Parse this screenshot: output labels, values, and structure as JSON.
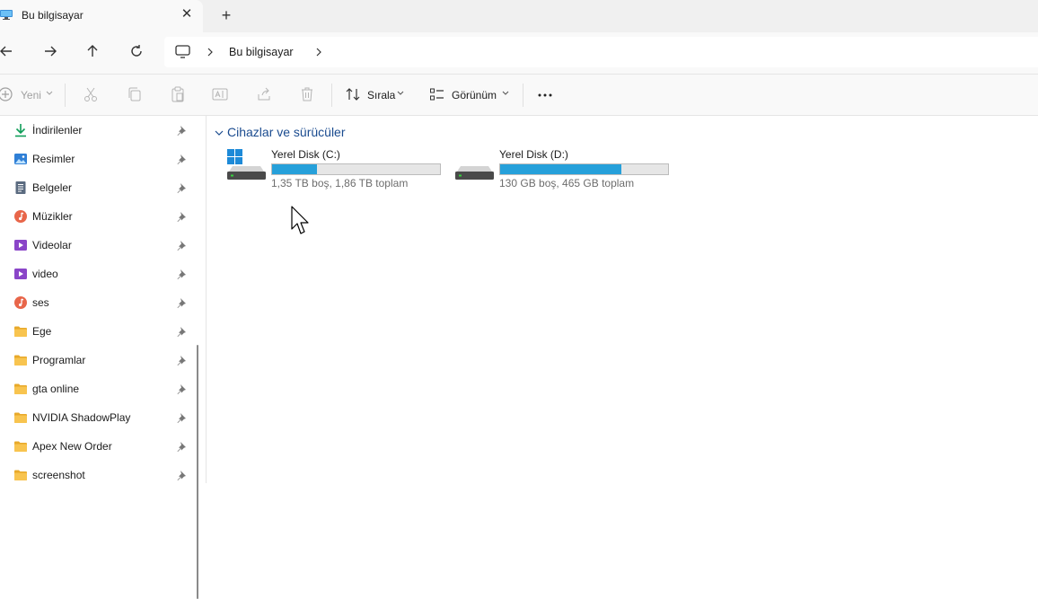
{
  "tab": {
    "title": "Bu bilgisayar"
  },
  "breadcrumb": {
    "items": [
      "Bu bilgisayar"
    ]
  },
  "toolbar": {
    "new_label": "Yeni",
    "sort_label": "Sırala",
    "view_label": "Görünüm"
  },
  "sidebar": {
    "items": [
      {
        "label": "İndirilenler",
        "icon": "download-icon"
      },
      {
        "label": "Resimler",
        "icon": "pictures-icon"
      },
      {
        "label": "Belgeler",
        "icon": "documents-icon"
      },
      {
        "label": "Müzikler",
        "icon": "music-icon"
      },
      {
        "label": "Videolar",
        "icon": "videos-icon"
      },
      {
        "label": "video",
        "icon": "videos-icon"
      },
      {
        "label": "ses",
        "icon": "music-icon"
      },
      {
        "label": "Ege",
        "icon": "folder-icon"
      },
      {
        "label": "Programlar",
        "icon": "folder-icon"
      },
      {
        "label": "gta online",
        "icon": "folder-icon"
      },
      {
        "label": "NVIDIA ShadowPlay",
        "icon": "folder-icon"
      },
      {
        "label": "Apex New Order",
        "icon": "folder-icon"
      },
      {
        "label": "screenshot",
        "icon": "folder-icon"
      }
    ]
  },
  "content": {
    "group_title": "Cihazlar ve sürücüler",
    "drives": [
      {
        "name": "Yerel Disk (C:)",
        "space": "1,35 TB boş, 1,86 TB toplam",
        "used_fraction": 0.27,
        "icon": "system-drive-icon"
      },
      {
        "name": "Yerel Disk (D:)",
        "space": "130 GB boş, 465 GB toplam",
        "used_fraction": 0.72,
        "icon": "drive-icon"
      }
    ]
  },
  "colors": {
    "accent": "#26a0da",
    "folder": "#f8c44f",
    "group_title": "#1a4b8f"
  }
}
